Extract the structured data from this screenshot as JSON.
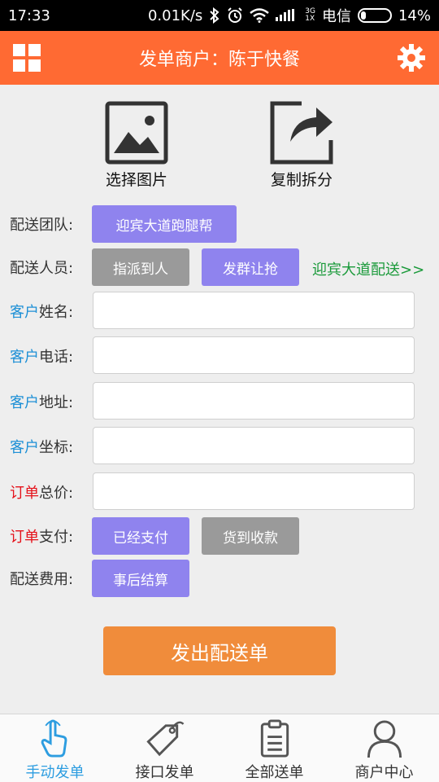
{
  "status_bar": {
    "time": "17:33",
    "speed": "0.01K/s",
    "network_top": "3G",
    "network_bottom": "1X",
    "carrier": "电信",
    "battery": "14%",
    "battery_level": 0.14
  },
  "header": {
    "title": "发单商户：陈于快餐",
    "menu_icon": "grid-icon",
    "settings_icon": "gear-icon"
  },
  "tools": {
    "select_image_label": "选择图片",
    "copy_split_label": "复制拆分"
  },
  "form": {
    "team_label": "配送团队:",
    "team_value": "迎宾大道跑腿帮",
    "staff_label": "配送人员:",
    "staff_assign": "指派到人",
    "staff_group": "发群让抢",
    "staff_link": "迎宾大道配送>>",
    "customer_prefix": "客户",
    "name_suffix": "姓名:",
    "phone_suffix": "电话:",
    "address_suffix": "地址:",
    "coords_suffix": "坐标:",
    "order_prefix": "订单",
    "total_suffix": "总价:",
    "payment_suffix": "支付:",
    "paid_label": "已经支付",
    "cod_label": "货到收款",
    "fee_label": "配送费用:",
    "fee_value": "事后结算"
  },
  "submit_label": "发出配送单",
  "tabbar": {
    "tabs": [
      {
        "label": "手动发单",
        "icon": "hand-pointer-icon",
        "active": true
      },
      {
        "label": "接口发单",
        "icon": "tag-icon",
        "active": false
      },
      {
        "label": "全部送单",
        "icon": "clipboard-icon",
        "active": false
      },
      {
        "label": "商户中心",
        "icon": "user-icon",
        "active": false
      }
    ]
  },
  "colors": {
    "header": "#ff6a33",
    "purple_button": "#8f83ee",
    "gray_button": "#9a9a9a",
    "submit": "#f08c3b",
    "active_tab": "#2d9de0",
    "link": "#1a9a3a"
  }
}
